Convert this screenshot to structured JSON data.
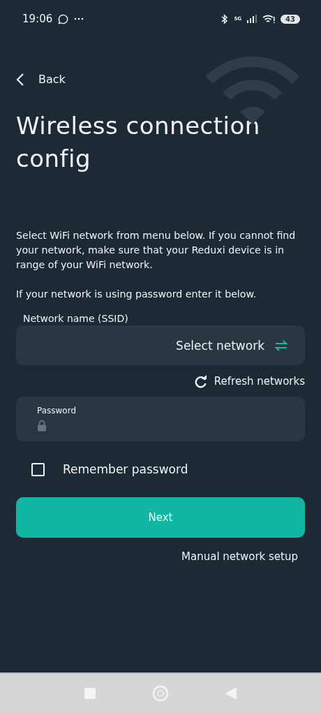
{
  "status_bar": {
    "time": "19:06",
    "network": "5G",
    "battery": "43"
  },
  "back": {
    "label": "Back"
  },
  "title": "Wireless connection config",
  "intro": [
    "Select WiFi network from menu below. If you cannot find your network, make sure that your Reduxi device is in range of your WiFi network.",
    "If your network is using password enter it below."
  ],
  "network_field": {
    "label": "Network name (SSID)",
    "value": "Select network"
  },
  "refresh": {
    "label": "Refresh networks"
  },
  "password_field": {
    "label": "Password"
  },
  "remember": {
    "label": "Remember password",
    "checked": false
  },
  "next_button": {
    "label": "Next"
  },
  "manual_link": {
    "label": "Manual network setup"
  }
}
